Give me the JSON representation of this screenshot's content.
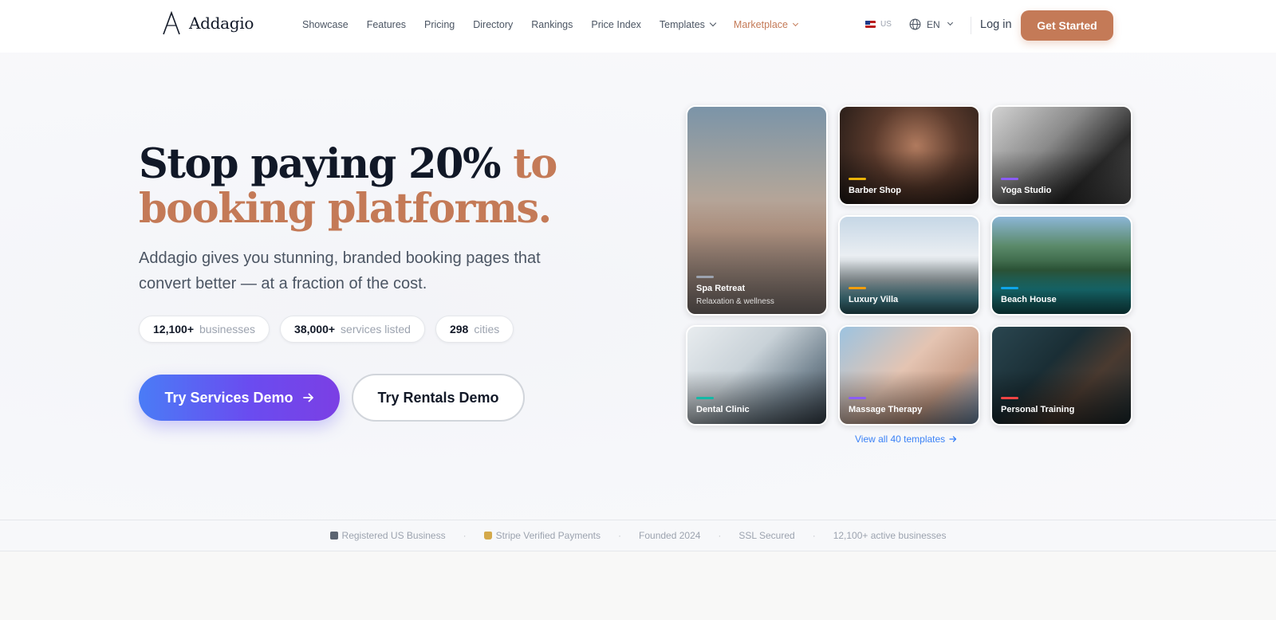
{
  "brand": {
    "name": "Addagio"
  },
  "nav": {
    "items": [
      {
        "label": "Showcase"
      },
      {
        "label": "Features"
      },
      {
        "label": "Pricing"
      },
      {
        "label": "Directory"
      },
      {
        "label": "Rankings"
      },
      {
        "label": "Price Index"
      }
    ],
    "templates_label": "Templates",
    "marketplace_label": "Marketplace",
    "region": "US",
    "language": "EN",
    "login_label": "Log in",
    "cta_label": "Get Started",
    "accent_color": "#c47a57"
  },
  "hero": {
    "headline_part1": "Stop paying 20%",
    "headline_part2": "to booking platforms.",
    "subheadline": "Addagio gives you stunning, branded booking pages that convert better — at a fraction of the cost.",
    "stats": [
      {
        "value": "12,100+",
        "label": "businesses"
      },
      {
        "value": "38,000+",
        "label": "services listed"
      },
      {
        "value": "298",
        "label": "cities"
      }
    ],
    "primary_cta": "Try Services Demo",
    "secondary_cta": "Try Rentals Demo"
  },
  "templates": {
    "tiles": [
      {
        "name": "Spa Retreat",
        "subtitle": "Relaxation & wellness",
        "accent": "#9ca3af"
      },
      {
        "name": "Barber Shop",
        "accent": "#eab308"
      },
      {
        "name": "Yoga Studio",
        "accent": "#8b5cf6"
      },
      {
        "name": "Luxury Villa",
        "accent": "#f59e0b"
      },
      {
        "name": "Beach House",
        "accent": "#0ea5e9"
      },
      {
        "name": "Dental Clinic",
        "accent": "#14b8a6"
      },
      {
        "name": "Massage Therapy",
        "accent": "#8b5cf6"
      },
      {
        "name": "Personal Training",
        "accent": "#ef4444"
      }
    ],
    "view_all_label": "View all 40 templates"
  },
  "trust_bar": {
    "items": [
      {
        "label": "Registered US Business",
        "icon": "building-icon"
      },
      {
        "label": "Stripe Verified Payments",
        "icon": "lock-icon"
      },
      {
        "label": "Founded 2024"
      },
      {
        "label": "SSL Secured"
      },
      {
        "label": "12,100+ active businesses"
      }
    ]
  }
}
